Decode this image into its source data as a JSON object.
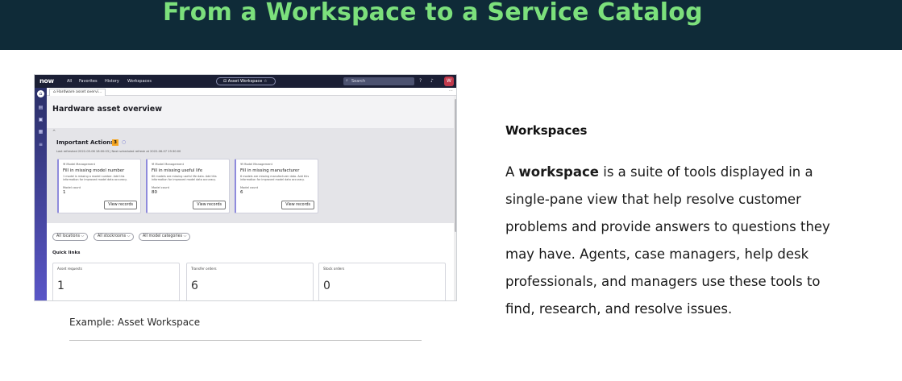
{
  "slide": {
    "title": "From a Workspace to a Service Catalog",
    "caption": "Example: Asset Workspace",
    "section_heading": "Workspaces",
    "paragraph": {
      "prefix": "A ",
      "bold_term": "workspace",
      "line1_rest": " is a suite of tools displayed in a",
      "lines": [
        "single-pane view that help resolve customer",
        "problems and provide answers to questions they",
        "may have. Agents, case managers, help desk",
        "professionals, and managers use these tools to",
        "find, research, and resolve issues."
      ]
    }
  },
  "screenshot": {
    "logo": "now",
    "nav_links": [
      "All",
      "Favorites",
      "History",
      "Workspaces"
    ],
    "workspace_pill": "⊟ Asset Workspace ☆",
    "search_placeholder": "Search",
    "avatar_initials": "W",
    "tab_label": "Hardware asset overvi...",
    "page_title": "Hardware asset overview",
    "important_actions": {
      "title": "Important Actions",
      "count": "3",
      "meta": "Last refreshed 2022-05-06 18:00:03 | Next scheduled refresh at 2022-06-07 19:30:00",
      "cards": [
        {
          "tag": "Model Management",
          "title": "Fill in missing model number",
          "desc": "1 model is missing a model number. Add this information for improved model data accuracy.",
          "count_label": "Model count",
          "count_value": "1",
          "button": "View records"
        },
        {
          "tag": "Model Management",
          "title": "Fill in missing useful life",
          "desc": "80 models are missing useful life data. Add this information for improved model data accuracy.",
          "count_label": "Model count",
          "count_value": "80",
          "button": "View records"
        },
        {
          "tag": "Model Management",
          "title": "Fill in missing manufacturer",
          "desc": "6 models are missing manufacturer data. Add this information for improved model data accuracy.",
          "count_label": "Model count",
          "count_value": "6",
          "button": "View records"
        }
      ]
    },
    "filters": [
      "All locations ⌵",
      "All stockrooms ⌵",
      "All model categories ⌵"
    ],
    "quick_links": {
      "title": "Quick links",
      "items": [
        {
          "label": "Asset requests",
          "value": "1"
        },
        {
          "label": "Transfer orders",
          "value": "6"
        },
        {
          "label": "Stock orders",
          "value": "0"
        }
      ]
    }
  },
  "colors": {
    "header_bg": "#0f2b38",
    "title_green": "#7ce07c",
    "nav_bg": "#1b1f35",
    "badge": "#f5a623"
  }
}
